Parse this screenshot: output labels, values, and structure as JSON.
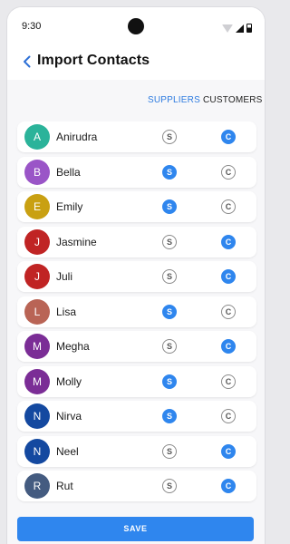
{
  "status": {
    "time": "9:30"
  },
  "header": {
    "title": "Import Contacts"
  },
  "tabs": {
    "suppliers": "SUPPLIERS",
    "customers": "CUSTOMERS"
  },
  "contacts": [
    {
      "initial": "A",
      "name": "Anirudra",
      "color": "#2bb39a",
      "selected": "C"
    },
    {
      "initial": "B",
      "name": "Bella",
      "color": "#9a55c7",
      "selected": "S"
    },
    {
      "initial": "E",
      "name": "Emily",
      "color": "#c9a012",
      "selected": "S"
    },
    {
      "initial": "J",
      "name": "Jasmine",
      "color": "#c02424",
      "selected": "C"
    },
    {
      "initial": "J",
      "name": "Juli",
      "color": "#c02424",
      "selected": "C"
    },
    {
      "initial": "L",
      "name": "Lisa",
      "color": "#b96455",
      "selected": "S"
    },
    {
      "initial": "M",
      "name": "Megha",
      "color": "#7b2d96",
      "selected": "C"
    },
    {
      "initial": "M",
      "name": "Molly",
      "color": "#7b2d96",
      "selected": "S"
    },
    {
      "initial": "N",
      "name": "Nirva",
      "color": "#1449a0",
      "selected": "S"
    },
    {
      "initial": "N",
      "name": "Neel",
      "color": "#1449a0",
      "selected": "C"
    },
    {
      "initial": "R",
      "name": "Rut",
      "color": "#445b80",
      "selected": "C"
    }
  ],
  "radio_labels": {
    "supplier": "S",
    "customer": "C"
  },
  "footer": {
    "save_label": "SAVE"
  },
  "colors": {
    "accent": "#2f86ee"
  }
}
